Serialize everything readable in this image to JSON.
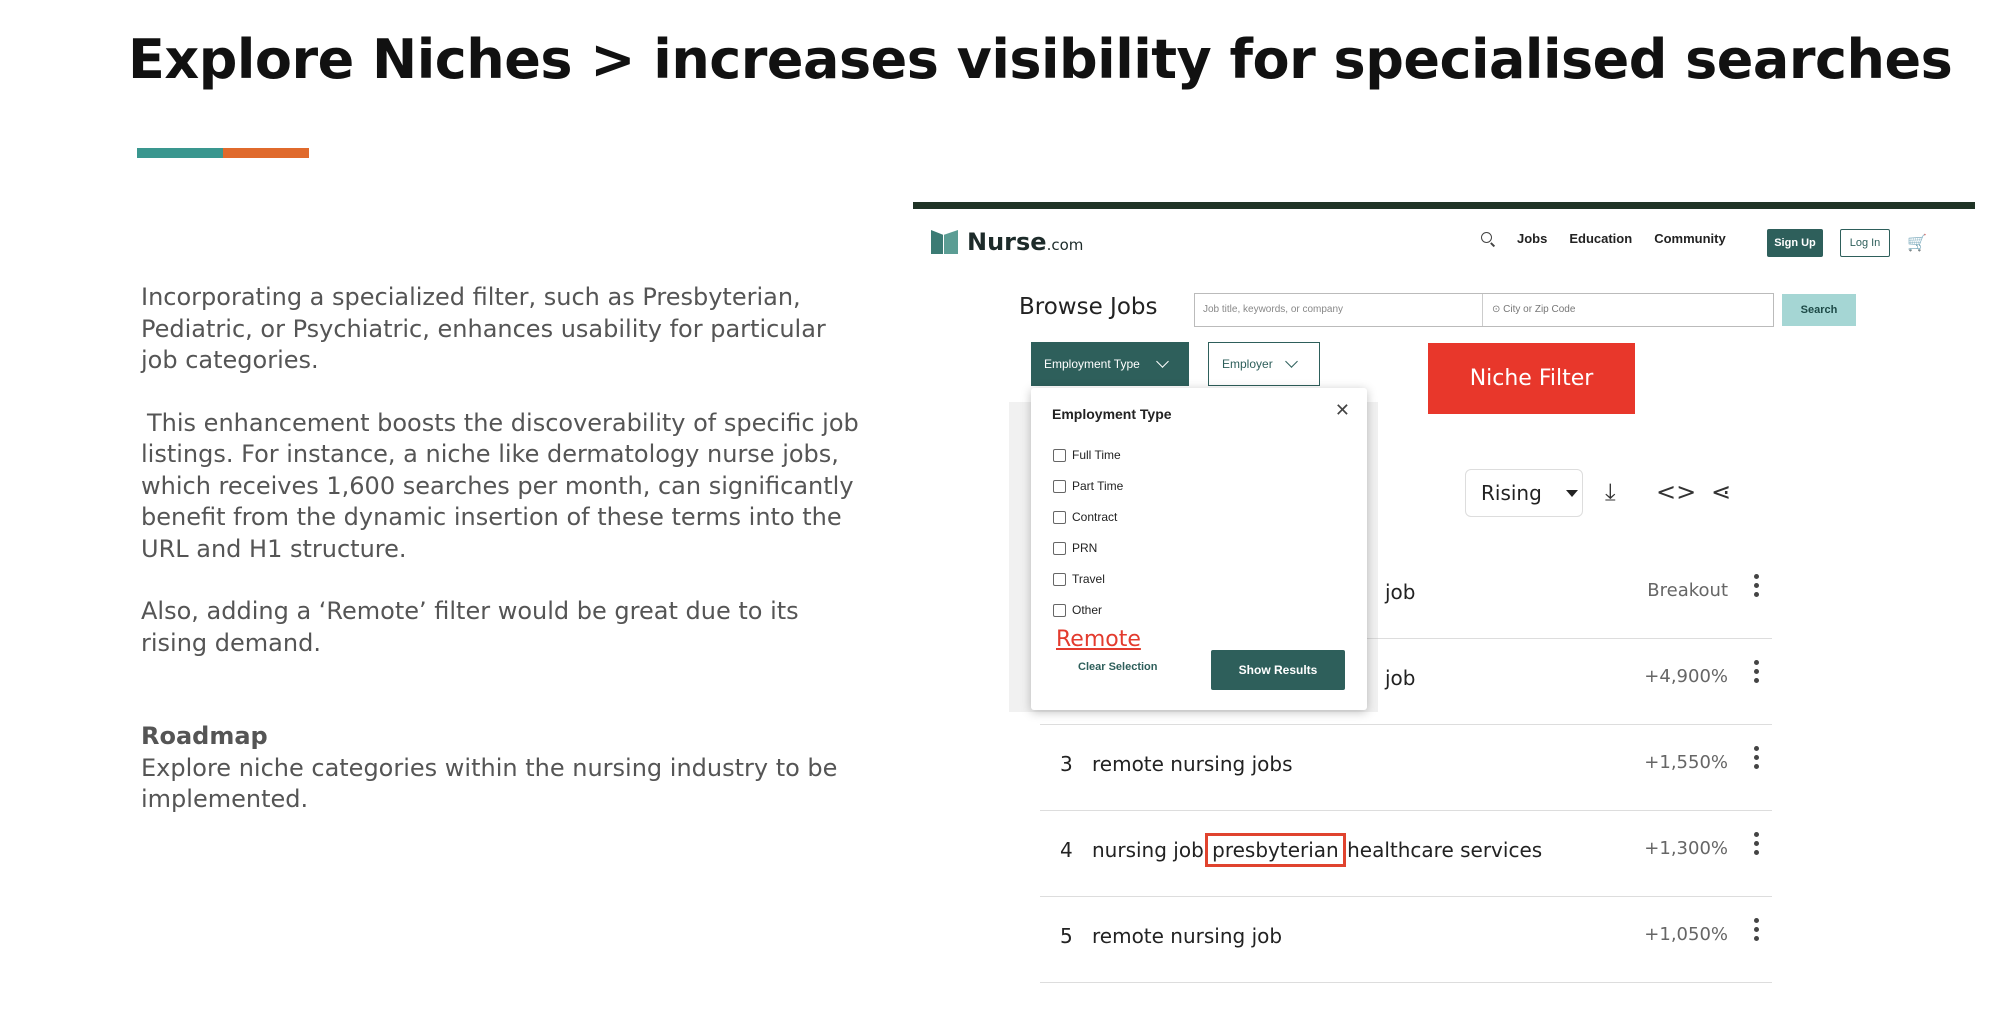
{
  "slide": {
    "title": "Explore Niches > increases visibility for specialised searches",
    "paragraph1": "Incorporating a specialized filter, such as Presbyterian, Pediatric, or Psychiatric, enhances usability for particular job categories.",
    "paragraph2": "This enhancement boosts the discoverability of specific job listings. For instance, a niche like dermatology nurse jobs, which receives 1,600 searches per month, can significantly benefit from the dynamic insertion of these terms into the URL and H1 structure.",
    "paragraph3": "Also, adding a ‘Remote’ filter would be great due to its rising demand.",
    "roadmap_heading": "Roadmap",
    "roadmap_text": "Explore niche categories within the nursing industry to be implemented.",
    "accent_colors": [
      "#3a978f",
      "#e06a2c"
    ]
  },
  "site": {
    "logo_text": "Nurse",
    "logo_suffix": ".com",
    "nav": [
      "Jobs",
      "Education",
      "Community"
    ],
    "signup": "Sign Up",
    "login": "Log In",
    "page_heading": "Browse Jobs",
    "search_placeholder": "Job title, keywords, or company",
    "location_placeholder": "City or Zip Code",
    "search_button": "Search",
    "filters": {
      "employment_type": "Employment Type",
      "employer": "Employer"
    },
    "niche_label": "Niche Filter"
  },
  "popup": {
    "title": "Employment Type",
    "options": [
      "Full Time",
      "Part Time",
      "Contract",
      "PRN",
      "Travel",
      "Other"
    ],
    "remote_label": "Remote",
    "clear": "Clear Selection",
    "show": "Show Results"
  },
  "trends": {
    "sort": "Rising",
    "rows": [
      {
        "rank": "",
        "query": "job",
        "value": "Breakout"
      },
      {
        "rank": "",
        "query": "job",
        "value": "+4,900%"
      },
      {
        "rank": "3",
        "query": "remote nursing jobs",
        "value": "+1,550%"
      },
      {
        "rank": "4",
        "query_before": "nursing job",
        "query_highlight": "presbyterian",
        "query_after": "healthcare services",
        "value": "+1,300%"
      },
      {
        "rank": "5",
        "query": "remote nursing job",
        "value": "+1,050%"
      }
    ]
  }
}
